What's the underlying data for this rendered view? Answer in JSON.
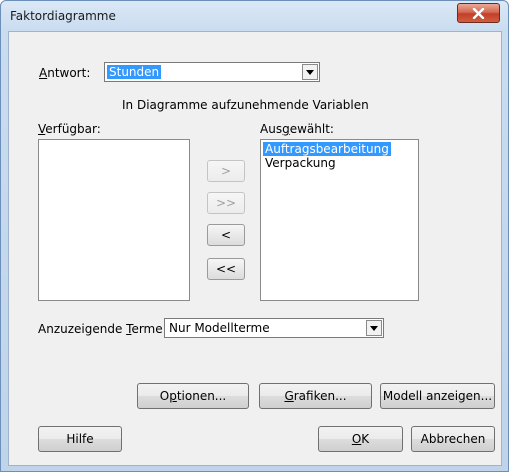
{
  "window": {
    "title": "Faktordiagramme"
  },
  "response": {
    "label_u": "A",
    "label_rest": "ntwort:",
    "value": "Stunden"
  },
  "section_heading": "In Diagramme aufzunehmende Variablen",
  "available": {
    "label_u": "V",
    "label_rest": "erfügbar:",
    "items": []
  },
  "selected": {
    "label_pre": "Aus",
    "label_u": "g",
    "label_post": "ewählt:",
    "items": [
      "Auftragsbearbeitung",
      "Verpackung"
    ]
  },
  "move_buttons": {
    "add": ">",
    "add_all": ">>",
    "remove": "<",
    "remove_all": "<<"
  },
  "terms": {
    "label_pre": "Anzuzeigende ",
    "label_u": "T",
    "label_post": "erme:",
    "value": "Nur Modellterme"
  },
  "buttons": {
    "options": {
      "u": "p",
      "pre": "O",
      "post": "tionen..."
    },
    "graphs": {
      "u": "G",
      "pre": "",
      "post": "rafiken..."
    },
    "show_model": "Modell anzeigen...",
    "help": "Hilfe",
    "ok": {
      "u": "O",
      "post": "K"
    },
    "cancel": "Abbrechen"
  }
}
